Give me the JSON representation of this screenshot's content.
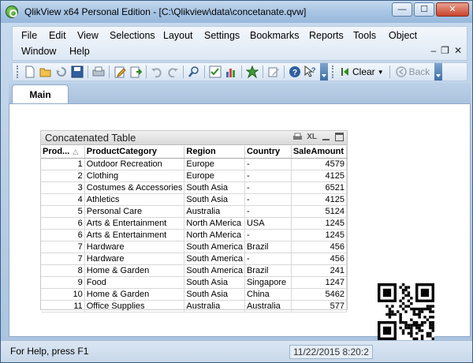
{
  "window": {
    "title": "QlikView x64 Personal Edition - [C:\\Qlikview\\data\\concetanate.qvw]",
    "minimize": "—",
    "maximize": "☐",
    "close": "✕"
  },
  "menu": {
    "items": [
      "File",
      "Edit",
      "View",
      "Selections",
      "Layout",
      "Settings",
      "Bookmarks",
      "Reports",
      "Tools",
      "Object"
    ],
    "items_row2": [
      "Window",
      "Help"
    ],
    "mdi_minimize": "–",
    "mdi_restore": "❐",
    "mdi_close": "✕"
  },
  "toolbar": {
    "clear_label": "Clear",
    "back_label": "Back",
    "icons": [
      "new-icon",
      "open-icon",
      "reload-icon",
      "save-icon",
      "print-icon",
      "edit-script-icon",
      "export-icon",
      "undo-icon",
      "redo-icon",
      "search-icon",
      "select-fields-icon",
      "new-chart-icon",
      "add-bookmark-icon",
      "edit-icon",
      "help-icon",
      "whats-this-icon"
    ]
  },
  "tabs": [
    {
      "label": "Main"
    }
  ],
  "table": {
    "title": "Concatenated Table",
    "xl_label": "XL",
    "columns": [
      "Prod...",
      "ProductCategory",
      "Region",
      "Country",
      "SaleAmount"
    ],
    "rows": [
      [
        "1",
        "Outdoor Recreation",
        "Europe",
        "-",
        "4579"
      ],
      [
        "2",
        "Clothing",
        "Europe",
        "-",
        "4125"
      ],
      [
        "3",
        "Costumes & Accessories",
        "South Asia",
        "-",
        "6521"
      ],
      [
        "4",
        "Athletics",
        "South Asia",
        "-",
        "4125"
      ],
      [
        "5",
        "Personal Care",
        "Australia",
        "-",
        "5124"
      ],
      [
        "6",
        "Arts & Entertainment",
        "North AMerica",
        "USA",
        "1245"
      ],
      [
        "6",
        "Arts & Entertainment",
        "North AMerica",
        "-",
        "1245"
      ],
      [
        "7",
        "Hardware",
        "South America",
        "Brazil",
        "456"
      ],
      [
        "7",
        "Hardware",
        "South America",
        "-",
        "456"
      ],
      [
        "8",
        "Home & Garden",
        "South America",
        "Brazil",
        "241"
      ],
      [
        "9",
        "Food",
        "South Asia",
        "Singapore",
        "1247"
      ],
      [
        "10",
        "Home & Garden",
        "South Asia",
        "China",
        "5462"
      ],
      [
        "11",
        "Office Supplies",
        "Australia",
        "Australia",
        "577"
      ]
    ]
  },
  "statusbar": {
    "help_text": "For Help, press F1",
    "datetime": "11/22/2015 8:20:2"
  },
  "colors": {
    "window_frame": "#a9c3df",
    "close_button": "#c9452c",
    "sheet_background": "#ffffff",
    "caption_background": "#d9d9d9"
  }
}
